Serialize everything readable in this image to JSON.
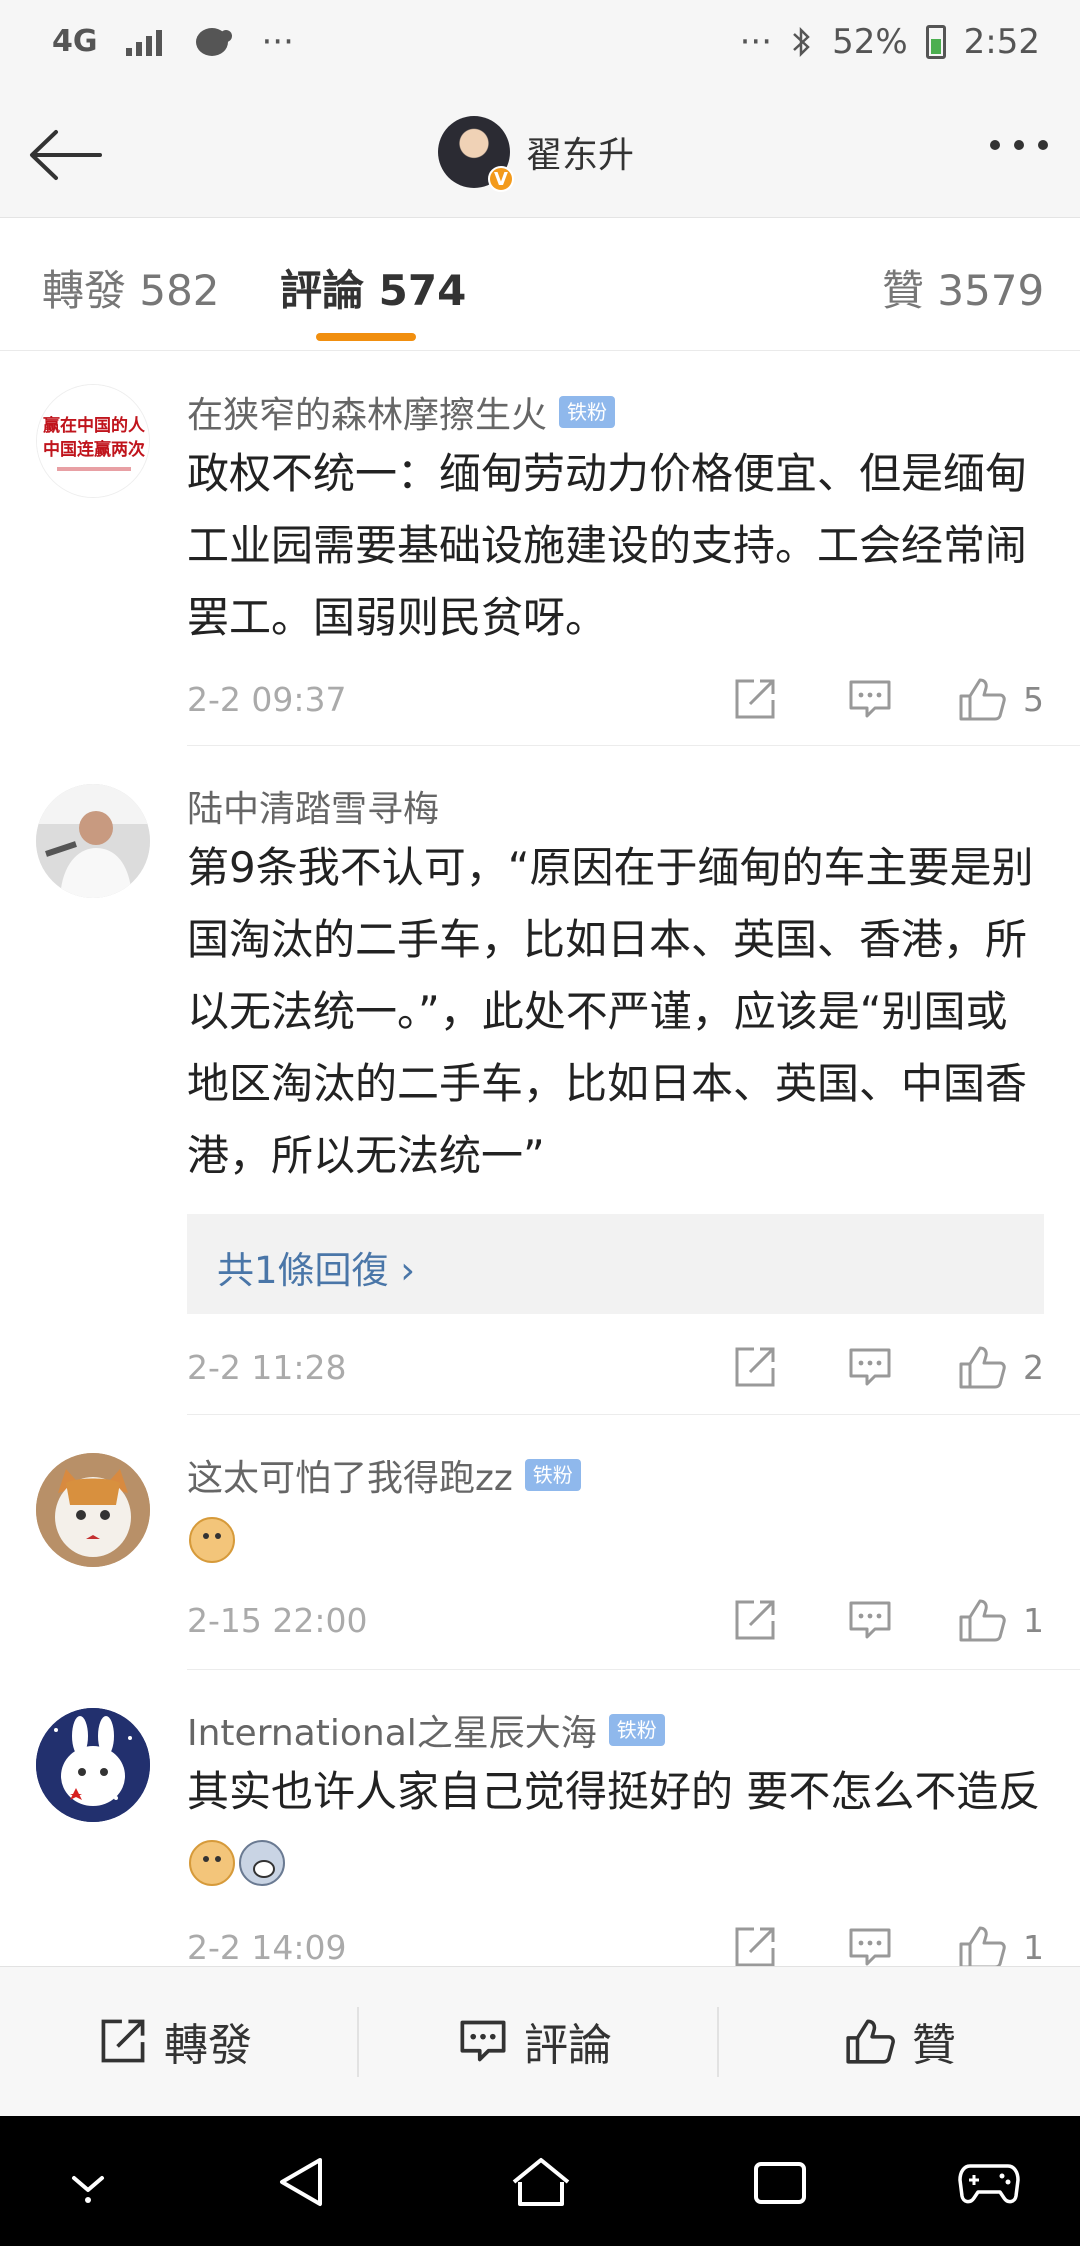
{
  "status_bar": {
    "network": "4G",
    "dots_left": "···",
    "dots_right": "···",
    "battery": "52%",
    "time": "2:52"
  },
  "header": {
    "name": "翟东升",
    "verified_badge": "V",
    "back_icon": "back-arrow-icon",
    "more_icon": "more-dots-icon"
  },
  "tabs": {
    "repost": "轉發 582",
    "comments": "評論 574",
    "likes": "贊 3579"
  },
  "comments": [
    {
      "user": "在狭窄的森林摩擦生火",
      "badge": "铁粉",
      "avatar_text": "赢在中国的人\n中国连赢两次",
      "text": "政权不统一：缅甸劳动力价格便宜、但是缅甸工业园需要基础设施建设的支持。工会经常闹罢工。国弱则民贫呀。",
      "time": "2-2 09:37",
      "likes": "5"
    },
    {
      "user": "陆中清踏雪寻梅",
      "text": "第9条我不认可，“原因在于缅甸的车主要是别国淘汰的二手车，比如日本、英国、香港，所以无法统一。”，此处不严谨，应该是“别国或地区淘汰的二手车，比如日本、英国、中国香港，所以无法统一”",
      "reply_link": "共1條回復 ›",
      "time": "2-2 11:28",
      "likes": "2"
    },
    {
      "user": "这太可怕了我得跑zz",
      "badge": "铁粉",
      "time": "2-15 22:00",
      "likes": "1"
    },
    {
      "user": "International之星辰大海",
      "badge": "铁粉",
      "text": "其实也许人家自己觉得挺好的 要不怎么不造反",
      "time": "2-2 14:09",
      "likes": "1"
    }
  ],
  "action_bar": {
    "repost": "轉發",
    "comment": "評論",
    "like": "贊"
  }
}
